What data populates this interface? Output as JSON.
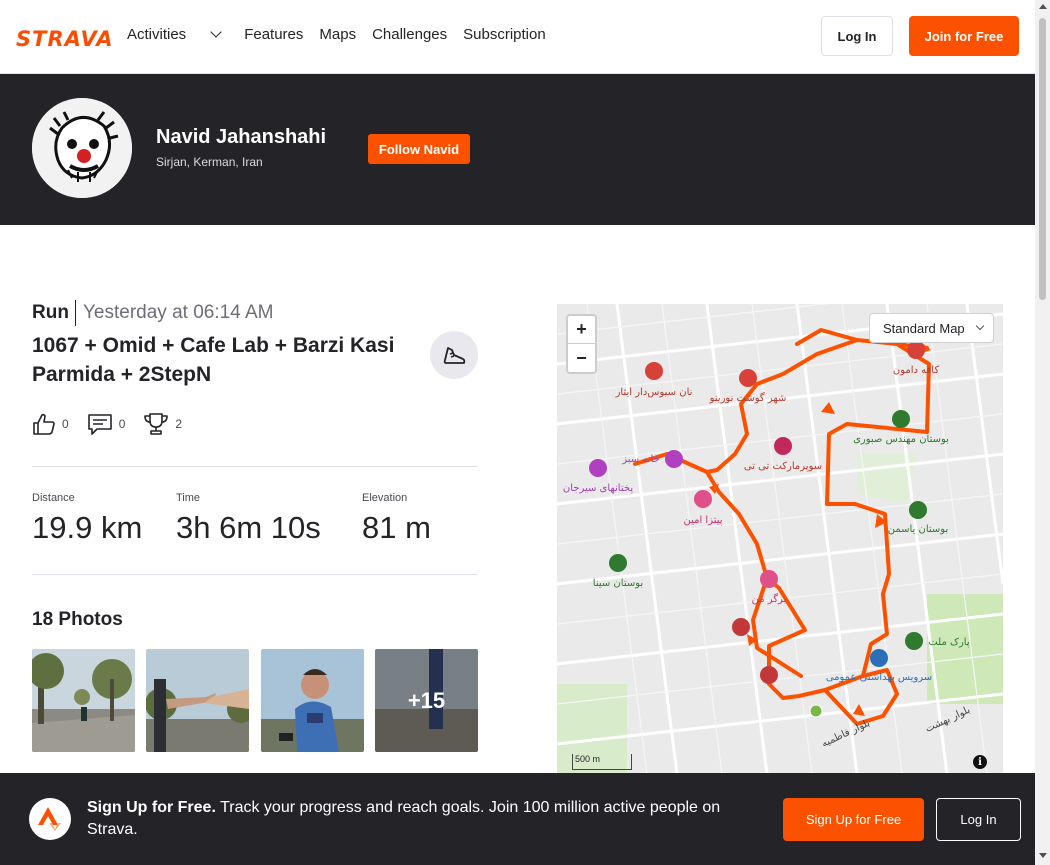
{
  "nav": {
    "logo": "STRAVA",
    "links": [
      "Activities",
      "Features",
      "Maps",
      "Challenges",
      "Subscription"
    ],
    "login_label": "Log In",
    "join_label": "Join for Free"
  },
  "athlete": {
    "name": "Navid Jahanshahi",
    "location": "Sirjan, Kerman, Iran",
    "follow_label": "Follow Navid"
  },
  "activity": {
    "type": "Run",
    "date": "Yesterday at 06:14 AM",
    "title": "1067 + Omid + Cafe Lab + Barzi Kasi Parmida + 2StepN",
    "kudos": "0",
    "comments": "0",
    "achievements": "2",
    "stats": [
      {
        "label": "Distance",
        "value": "19.9 km"
      },
      {
        "label": "Time",
        "value": "3h 6m 10s"
      },
      {
        "label": "Elevation",
        "value": "81 m"
      }
    ]
  },
  "photos": {
    "heading": "18 Photos",
    "more_label": "+15"
  },
  "map": {
    "type_select": "Standard Map",
    "scale_label": "500 m",
    "route_color": "#fc5200",
    "pois": [
      {
        "label": "نان سبوس‌دار ایثار",
        "kind": "cafe"
      },
      {
        "label": "شهر گوشت نورینو",
        "kind": "shop"
      },
      {
        "label": "کافه دامون",
        "kind": "cafe"
      },
      {
        "label": "بوستان مهندس صبوری",
        "kind": "park"
      },
      {
        "label": "سوپرمارکت تی تی",
        "kind": "shop"
      },
      {
        "label": "خانه سبز",
        "kind": "venue"
      },
      {
        "label": "پختانهای سیرجان",
        "kind": "venue"
      },
      {
        "label": "پیتزا امین",
        "kind": "food"
      },
      {
        "label": "بوستان یاسمن",
        "kind": "park"
      },
      {
        "label": "بوستان سینا",
        "kind": "park"
      },
      {
        "label": "برگر من",
        "kind": "food"
      },
      {
        "label": "پارک ملت",
        "kind": "park"
      },
      {
        "label": "سرویس بهداشتی عمومی",
        "kind": "wc"
      },
      {
        "label": "بلوار فاطمیه",
        "kind": "street"
      },
      {
        "label": "بلوار بهشت",
        "kind": "street"
      }
    ]
  },
  "signup": {
    "lead": "Sign Up for Free.",
    "text": "Track your progress and reach goals. Join 100 million active people on Strava.",
    "join_label": "Sign Up for Free",
    "login_label": "Log In"
  }
}
